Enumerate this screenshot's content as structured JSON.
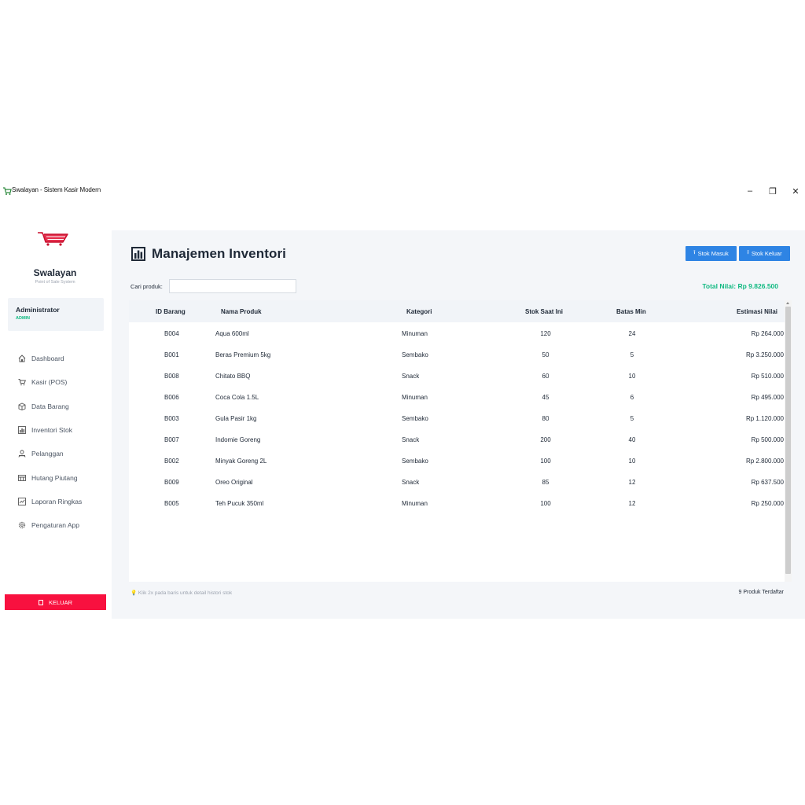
{
  "window": {
    "title": "Swalayan - Sistem Kasir Modern",
    "controls": {
      "minimize": "–",
      "maximize": "❐",
      "close": "✕"
    }
  },
  "sidebar": {
    "logo_icon": "cart-logo",
    "brand": "Swalayan",
    "brand_sub": "Point of Sale System",
    "user": {
      "name": "Administrator",
      "role": "ADMIN"
    },
    "items": [
      {
        "label": "Dashboard",
        "icon": "home-icon"
      },
      {
        "label": "Kasir (POS)",
        "icon": "cart-icon"
      },
      {
        "label": "Data Barang",
        "icon": "box-icon"
      },
      {
        "label": "Inventori Stok",
        "icon": "chart-icon"
      },
      {
        "label": "Pelanggan",
        "icon": "users-icon"
      },
      {
        "label": "Hutang Piutang",
        "icon": "ledger-icon"
      },
      {
        "label": "Laporan Ringkas",
        "icon": "report-icon"
      },
      {
        "label": "Pengaturan App",
        "icon": "gear-icon"
      }
    ],
    "logout": "KELUAR"
  },
  "main": {
    "title": "Manajemen Inventori",
    "buttons": {
      "stok_masuk": "Stok Masuk",
      "stok_keluar": "Stok Keluar"
    },
    "search": {
      "label": "Cari produk:",
      "value": "",
      "placeholder": ""
    },
    "total": "Total Nilai: Rp 9.826.500",
    "table": {
      "columns": [
        "ID Barang",
        "Nama Produk",
        "Kategori",
        "Stok Saat Ini",
        "Batas Min",
        "Estimasi Nilai"
      ],
      "rows": [
        [
          "B004",
          "Aqua 600ml",
          "Minuman",
          "120",
          "24",
          "Rp 264.000"
        ],
        [
          "B001",
          "Beras Premium 5kg",
          "Sembako",
          "50",
          "5",
          "Rp 3.250.000"
        ],
        [
          "B008",
          "Chitato BBQ",
          "Snack",
          "60",
          "10",
          "Rp 510.000"
        ],
        [
          "B006",
          "Coca Cola 1.5L",
          "Minuman",
          "45",
          "6",
          "Rp 495.000"
        ],
        [
          "B003",
          "Gula Pasir 1kg",
          "Sembako",
          "80",
          "5",
          "Rp 1.120.000"
        ],
        [
          "B007",
          "Indomie Goreng",
          "Snack",
          "200",
          "40",
          "Rp 500.000"
        ],
        [
          "B002",
          "Minyak Goreng 2L",
          "Sembako",
          "100",
          "10",
          "Rp 2.800.000"
        ],
        [
          "B009",
          "Oreo Original",
          "Snack",
          "85",
          "12",
          "Rp 637.500"
        ],
        [
          "B005",
          "Teh Pucuk 350ml",
          "Minuman",
          "100",
          "12",
          "Rp 250.000"
        ]
      ]
    },
    "footer_hint": "💡 Klik 2x pada baris untuk detail histori stok",
    "footer_count": "9 Produk Terdaftar"
  },
  "colors": {
    "accent": "#2e84e4",
    "danger": "#f8113f",
    "success": "#10b981",
    "background": "#f4f6f9"
  }
}
